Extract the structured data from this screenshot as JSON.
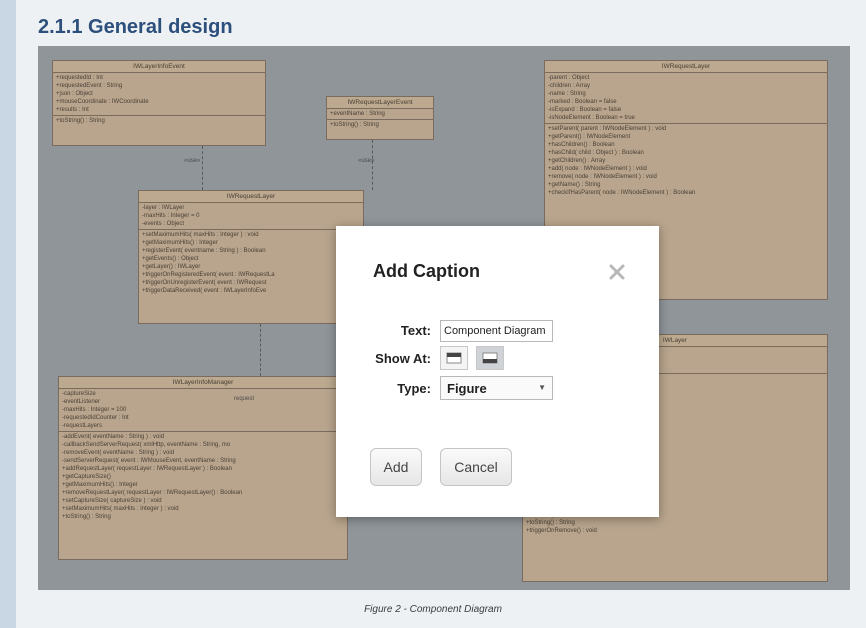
{
  "heading": "2.1.1 General design",
  "caption": "Figure 2 - Component Diagram",
  "diagram": {
    "classes": [
      {
        "id": "infoEvent",
        "name": "IWLayerInfoEvent",
        "sections": [
          [
            "+requestedId : Int",
            "+requestedEvent : String",
            "+json : Object",
            "+mouseCoordinate : IWCoordinate",
            "+results : Int"
          ],
          [
            "+toString() : String"
          ]
        ]
      },
      {
        "id": "reqLayerEvent",
        "name": "IWRequestLayerEvent",
        "sections": [
          [
            "+eventName : String"
          ],
          [
            "+toString() : String"
          ]
        ]
      },
      {
        "id": "reqLayerRight",
        "name": "IWRequestLayer",
        "sections": [
          [
            "-parent : Object",
            "-children : Array",
            "-name : String",
            "-marked : Boolean = false",
            "-isExpand : Boolean = false",
            "-isNodeElement : Boolean = true"
          ],
          [
            "+setParent( parent : IWNodeElement ) : void",
            "+getParent() : IWNodeElement",
            "+hasChildren() : Boolean",
            "+hasChild( child : Object ) : Boolean",
            "+getChildren() : Array",
            "+add( node : IWNodeElement ) : void",
            "+remove( node : IWNodeElement ) : void",
            "+getName() : String",
            "+checkIfHasParent( node : IWNodeElement ) : Boolean",
            "",
            "",
            "",
            "",
            "",
            "",
            "",
            "( ) : void"
          ]
        ]
      },
      {
        "id": "reqLayerMid",
        "name": "IWRequestLayer",
        "sections": [
          [
            "-layer : IWLayer",
            "-maxHits : Integer = 0",
            "-events : Object"
          ],
          [
            "+setMaximumHits( maxHits : Integer ) : void",
            "+getMaximumHits() : Integer",
            "+registerEvent( eventname : String ) : Boolean",
            "+getEvents() : Object",
            "+getLayer() : IWLayer",
            "+triggerOnRegisteredEvent( event : IWRequestLa",
            "+triggerOnUnregisterEvent( event : IWRequest",
            "+triggerDataReceived( event : IWLayerInfoEve"
          ]
        ]
      },
      {
        "id": "infoManager",
        "name": "IWLayerInfoManager",
        "sections": [
          [
            "-captureSize",
            "-eventListener",
            "-maxHits : Integer = 100",
            "-requestedIdCounter : Int",
            "-requestLayers"
          ],
          [
            "-addEvent( eventName : String ) : void",
            "-callbackSendServerRequest( xmlHttp, eventName : String, mo",
            "-removeEvent( eventName : String ) : void",
            "-sendServerRequest( event : IWMouseEvent, eventName : String",
            "+addRequestLayer( requestLayer : IWRequestLayer ) : Boolean",
            "+getCaptureSize()",
            "+getMaximumHits() : Integer",
            "+removeRequestLayer( requestLayer : IWRequestLayer() : Boolean",
            "+setCaptureSize( captureSize ) : void",
            "+setMaximumHits( maxHits : Integer ) : void",
            "+toString() : String"
          ]
        ]
      },
      {
        "id": "layerRight",
        "name": "IWLayer",
        "sections": [
          [
            "",
            "",
            ""
          ],
          [
            "ment ) : void",
            "ement ) : void",
            "Element ) : void",
            "Element ) : void",
            "e : String ) : void",
            "",
            "String ) : void",
            "",
            "",
            "omZoomLevel : Int) : String",
            "olean ) : void",
            "Name : String ) : void",
            "",
            "",
            "hape ) : Boolean",
            "+removeShape( shapeName : String ) : Boolean",
            "+getShapes() : Array",
            "+isVisible() : Boolean",
            "+toString() : String",
            "+triggerOnRemove() : void"
          ]
        ]
      }
    ],
    "stereotype_labels": [
      "«use»",
      "«use»"
    ],
    "association_label": "request"
  },
  "dialog": {
    "title": "Add Caption",
    "close_icon": "close-x-icon",
    "text_label": "Text:",
    "text_value": "Component Diagram",
    "show_at_label": "Show At:",
    "show_at_options": [
      "top",
      "bottom"
    ],
    "show_at_selected": "bottom",
    "type_label": "Type:",
    "type_value": "Figure",
    "add_label": "Add",
    "cancel_label": "Cancel"
  },
  "colors": {
    "heading": "#2c4f7c",
    "diagram_bg": "#8f9599",
    "class_fill": "#b9a58d"
  }
}
